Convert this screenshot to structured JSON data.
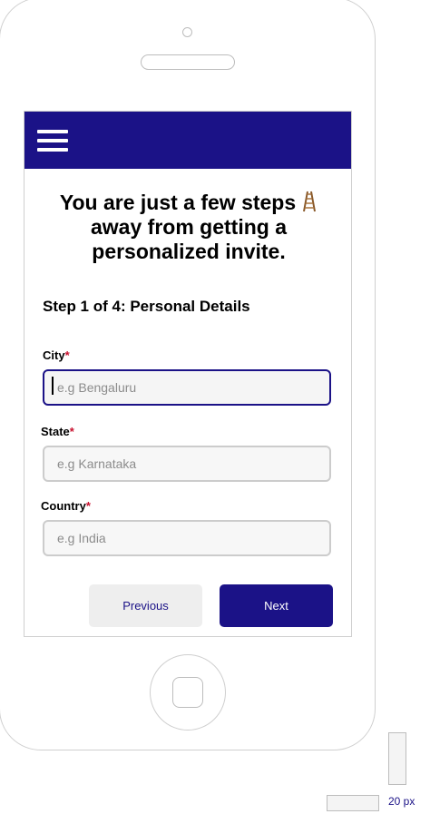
{
  "header": {
    "menu_icon": "hamburger-menu-icon",
    "bar_color": "#1b1287"
  },
  "headline": {
    "text": "You are just a few steps",
    "text2": "away from getting a personalized invite.",
    "emoji_icon": "ladder-icon"
  },
  "step": {
    "title": "Step 1 of 4: Personal Details"
  },
  "form": {
    "city": {
      "label": "City",
      "required": "*",
      "placeholder": "e.g Bengaluru",
      "value": ""
    },
    "state": {
      "label": "State",
      "required": "*",
      "placeholder": "e.g Karnataka",
      "value": ""
    },
    "country": {
      "label": "Country",
      "required": "*",
      "placeholder": "e.g India",
      "value": ""
    }
  },
  "buttons": {
    "previous": "Previous",
    "next": "Next"
  },
  "scale": {
    "label": "20 px"
  },
  "colors": {
    "accent": "#1b1287",
    "required": "#c8102e"
  }
}
